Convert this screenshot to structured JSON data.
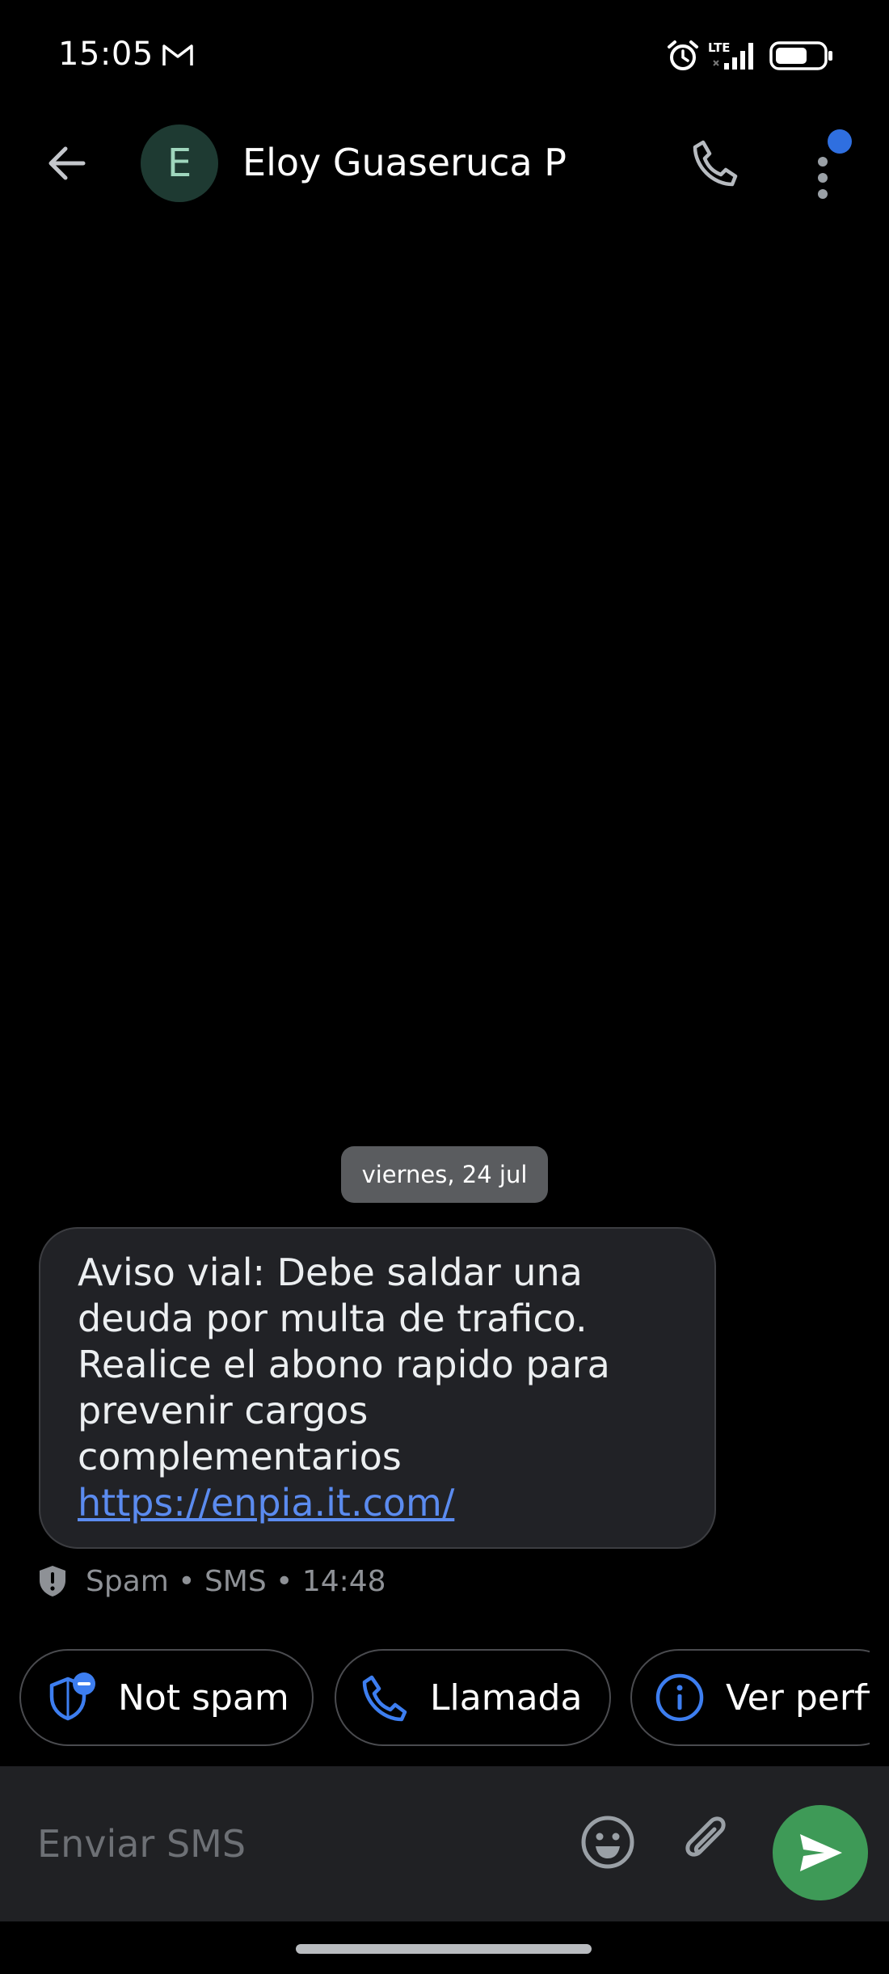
{
  "status_bar": {
    "time": "15:05",
    "network": "LTE",
    "icons": [
      "gmail-icon",
      "alarm-icon",
      "signal-icon",
      "battery-icon"
    ]
  },
  "header": {
    "avatar_letter": "E",
    "contact_name": "Eloy Guaseruca P",
    "icons": [
      "back-arrow-icon",
      "phone-icon",
      "more-vert-icon"
    ]
  },
  "conversation": {
    "date_label": "viernes, 24 jul",
    "message": {
      "text": "Aviso vial: Debe saldar una\ndeuda por multa de trafico.\nRealice el abono rapido para\nprevenir cargos\ncomplementarios",
      "link": "https://enpia.it.com/",
      "meta": "Spam • SMS • 14:48"
    }
  },
  "suggestions": [
    {
      "label": "Not spam",
      "icon": "shield-minus-icon"
    },
    {
      "label": "Llamada",
      "icon": "phone-icon"
    },
    {
      "label": "Ver perfil",
      "icon": "info-icon"
    }
  ],
  "compose": {
    "placeholder": "Enviar SMS",
    "value": "",
    "icons": [
      "emoji-icon",
      "attach-icon",
      "send-icon"
    ]
  },
  "colors": {
    "background": "#000000",
    "bubble": "#212226",
    "link": "#5b8bef",
    "accent_blue": "#2f6fe0",
    "send_green": "#3e9a57",
    "avatar_bg": "#1e3a32"
  }
}
